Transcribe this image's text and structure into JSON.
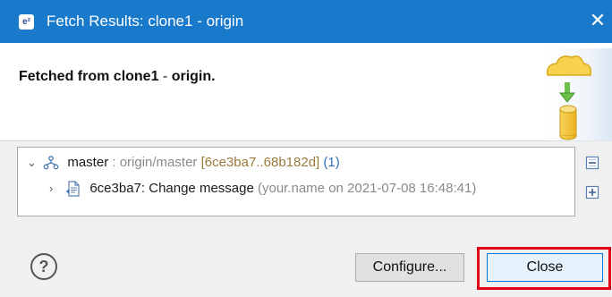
{
  "window": {
    "title": "Fetch Results: clone1 - origin",
    "app_icon_glyph": "e²",
    "close_glyph": "✕"
  },
  "banner": {
    "message_bold_1": "Fetched from clone1",
    "message_dash": " - ",
    "message_bold_2": "origin.",
    "icon": "fetch-cloud-database-icon"
  },
  "tree": {
    "branch": {
      "name": "master",
      "separator": " : ",
      "tracking": "origin/master",
      "range": "[6ce3ba7..68b182d]",
      "count": "(1)"
    },
    "commit": {
      "title": "6ce3ba7: Change message",
      "meta": "(your.name on 2021-07-08 16:48:41)"
    }
  },
  "buttons": {
    "help": "?",
    "configure": "Configure...",
    "close": "Close"
  },
  "colors": {
    "titlebar": "#1979ca",
    "highlight": "#e0001b"
  }
}
